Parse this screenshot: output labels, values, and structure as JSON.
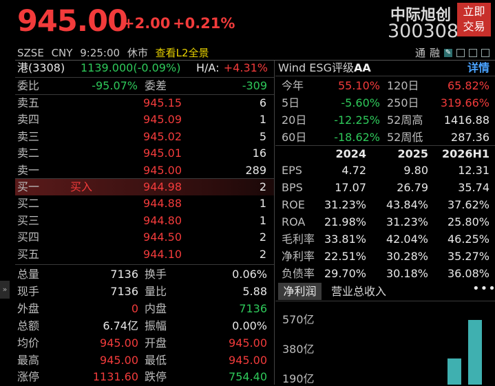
{
  "header": {
    "price": "945.00",
    "change": "+2.00",
    "change_pct": "+0.21%",
    "stock_name": "中际旭创",
    "stock_code": "300308",
    "trade_button": [
      "立即",
      "交易"
    ],
    "market": "SZSE",
    "currency": "CNY",
    "time": "9:25:00",
    "status": "休市",
    "l2_link": "查看L2全景",
    "tools_labels": [
      "通",
      "融"
    ]
  },
  "hk": {
    "label": "港(3308)",
    "value": "1139.000(-0.09%)",
    "ha_label": "H/A:",
    "ha_value": "+4.31%"
  },
  "committee": {
    "ratio_label": "委比",
    "ratio_value": "-95.07%",
    "diff_label": "委差",
    "diff_value": "-309"
  },
  "sell_orders": [
    {
      "label": "卖五",
      "price": "945.15",
      "qty": "6"
    },
    {
      "label": "卖四",
      "price": "945.09",
      "qty": "1"
    },
    {
      "label": "卖三",
      "price": "945.02",
      "qty": "5"
    },
    {
      "label": "卖二",
      "price": "945.01",
      "qty": "16"
    },
    {
      "label": "卖一",
      "price": "945.00",
      "qty": "289"
    }
  ],
  "buy_orders": [
    {
      "label": "买一",
      "tag": "买入",
      "price": "944.98",
      "qty": "2"
    },
    {
      "label": "买二",
      "tag": "",
      "price": "944.88",
      "qty": "1"
    },
    {
      "label": "买三",
      "tag": "",
      "price": "944.80",
      "qty": "1"
    },
    {
      "label": "买四",
      "tag": "",
      "price": "944.50",
      "qty": "2"
    },
    {
      "label": "买五",
      "tag": "",
      "price": "944.10",
      "qty": "2"
    }
  ],
  "stats": [
    {
      "l1": "总量",
      "v1": "7136",
      "c1": "white",
      "l2": "换手",
      "v2": "0.06%",
      "c2": "white"
    },
    {
      "l1": "现手",
      "v1": "7136",
      "c1": "white",
      "l2": "量比",
      "v2": "5.88",
      "c2": "white"
    },
    {
      "l1": "外盘",
      "v1": "0",
      "c1": "red",
      "l2": "内盘",
      "v2": "7136",
      "c2": "green"
    },
    {
      "l1": "总额",
      "v1": "6.74亿",
      "c1": "white",
      "l2": "振幅",
      "v2": "0.00%",
      "c2": "white"
    },
    {
      "l1": "均价",
      "v1": "945.00",
      "c1": "red",
      "l2": "开盘",
      "v2": "945.00",
      "c2": "red"
    },
    {
      "l1": "最高",
      "v1": "945.00",
      "c1": "red",
      "l2": "最低",
      "v2": "945.00",
      "c2": "red"
    },
    {
      "l1": "涨停",
      "v1": "1131.60",
      "c1": "red",
      "l2": "跌停",
      "v2": "754.40",
      "c2": "green"
    }
  ],
  "right_panel": {
    "title": "Wind ESG评级",
    "rating": "AA",
    "detail": "详情",
    "performance": [
      {
        "l1": "今年",
        "v1": "55.10%",
        "c1": "red",
        "l2": "120日",
        "v2": "65.82%",
        "c2": "red"
      },
      {
        "l1": "5日",
        "v1": "-5.60%",
        "c1": "green",
        "l2": "250日",
        "v2": "319.66%",
        "c2": "red"
      },
      {
        "l1": "20日",
        "v1": "-12.25%",
        "c1": "green",
        "l2": "52周高",
        "v2": "1416.88",
        "c2": "white"
      },
      {
        "l1": "60日",
        "v1": "-18.62%",
        "c1": "green",
        "l2": "52周低",
        "v2": "287.36",
        "c2": "white"
      }
    ],
    "fin_headers": [
      "2024",
      "2025",
      "2026H1"
    ],
    "fin_rows": [
      {
        "label": "EPS",
        "values": [
          "4.72",
          "9.80",
          "12.31"
        ]
      },
      {
        "label": "BPS",
        "values": [
          "17.07",
          "26.79",
          "35.74"
        ]
      },
      {
        "label": "ROE",
        "values": [
          "31.23%",
          "43.84%",
          "37.62%"
        ]
      },
      {
        "label": "ROA",
        "values": [
          "21.98%",
          "31.23%",
          "25.80%"
        ]
      },
      {
        "label": "毛利率",
        "values": [
          "33.81%",
          "42.04%",
          "46.25%"
        ]
      },
      {
        "label": "净利率",
        "values": [
          "22.51%",
          "30.28%",
          "35.27%"
        ]
      },
      {
        "label": "负债率",
        "values": [
          "29.70%",
          "30.18%",
          "36.08%"
        ]
      }
    ],
    "tabs": [
      "净利润",
      "营业总收入"
    ],
    "more": "•••",
    "y_labels": [
      "570亿",
      "380亿",
      "190亿"
    ]
  },
  "colors": {
    "up": "#f23b3b",
    "down": "#2ec95a",
    "accent": "#4aa3ff",
    "bar": "#3fb0b0",
    "trade_btn": "#c8302b"
  },
  "icons": [
    "edit-icon",
    "alert-icon",
    "share-icon",
    "expand-arrow-icon"
  ]
}
